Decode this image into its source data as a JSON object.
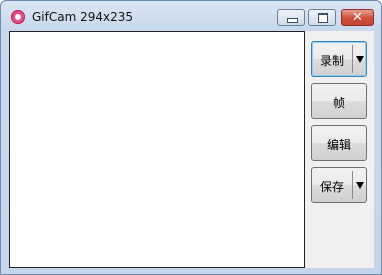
{
  "window": {
    "title": "GifCam 294x235",
    "controls": {
      "minimize": "minimize",
      "maximize": "maximize",
      "close": "✕"
    }
  },
  "buttons": {
    "record": "录制",
    "frame": "帧",
    "edit": "编辑",
    "save": "保存"
  }
}
